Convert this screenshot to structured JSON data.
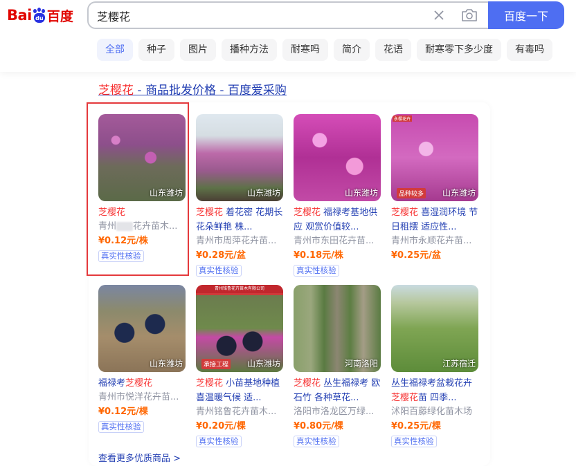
{
  "header": {
    "logo_latin": "Bai",
    "logo_paw_text": "du",
    "logo_cn": "百度",
    "search_value": "芝樱花",
    "search_button": "百度一下",
    "tabs": [
      {
        "label": "全部",
        "active": true
      },
      {
        "label": "种子"
      },
      {
        "label": "图片"
      },
      {
        "label": "播种方法"
      },
      {
        "label": "耐寒吗"
      },
      {
        "label": "简介"
      },
      {
        "label": "花语"
      },
      {
        "label": "耐寒零下多少度"
      },
      {
        "label": "有毒吗"
      }
    ]
  },
  "result": {
    "title_highlight": "芝樱花",
    "title_rest": " - 商品批发价格 - 百度爱采购",
    "products": [
      {
        "location": "山东潍坊",
        "name_hl": "芝樱花",
        "name_rest": "",
        "seller_a": "青州",
        "seller_b": "花卉苗木...",
        "price": "¥0.12元/株",
        "badge": "真实性核验"
      },
      {
        "location": "山东潍坊",
        "name_hl": "芝樱花",
        "name_rest": " 着花密 花期长 花朵鲜艳 株...",
        "seller": "青州市周萍花卉苗...",
        "price": "¥0.28元/盆",
        "badge": "真实性核验"
      },
      {
        "location": "山东潍坊",
        "name_hl": "芝樱花",
        "name_rest": " 福禄考基地供应 观赏价值较...",
        "seller": "青州市东田花卉苗...",
        "price": "¥0.18元/株",
        "badge": "真实性核验"
      },
      {
        "location": "山东潍坊",
        "name_hl": "芝樱花",
        "name_rest": " 喜湿润环境 节日租摆 适应性...",
        "seller": "青州市永顺花卉苗...",
        "price": "¥0.25元/盆",
        "badge": "",
        "img_tag": "永樱花卉",
        "img_bottom": "品种较多"
      },
      {
        "location": "山东潍坊",
        "name_pre": "福禄考",
        "name_hl": "芝樱花",
        "name_rest": "",
        "seller": "青州市悦洋花卉苗...",
        "price": "¥0.12元/棵",
        "badge": "真实性核验"
      },
      {
        "location": "山东潍坊",
        "name_hl": "芝樱花",
        "name_rest": " 小苗基地种植 喜温暖气候 适...",
        "seller": "青州铭鲁花卉苗木...",
        "price": "¥0.20元/棵",
        "badge": "真实性核验",
        "img_banner": "青州铭鲁花卉苗木有限公司",
        "img_bottom": "承接工程"
      },
      {
        "location": "河南洛阳",
        "name_hl": "芝樱花",
        "name_rest": " 丛生福禄考 欧石竹 各种草花...",
        "seller": "洛阳市洛龙区万绿...",
        "price": "¥0.80元/棵",
        "badge": "真实性核验"
      },
      {
        "location": "江苏宿迁",
        "name_pre": "丛生福禄考盆栽花卉 ",
        "name_hl": "芝樱花",
        "name_rest": "苗 四季...",
        "seller": "沭阳百藤绿化苗木场",
        "price": "¥0.25元/棵",
        "badge": "真实性核验"
      }
    ],
    "more_link": "查看更多优质商品 >"
  },
  "colors": {
    "brand_blue": "#4e6ef2",
    "title_blue": "#2440b3",
    "highlight_red": "#f73131",
    "price_orange": "#ff6600",
    "selection_box": "#e4393c"
  }
}
